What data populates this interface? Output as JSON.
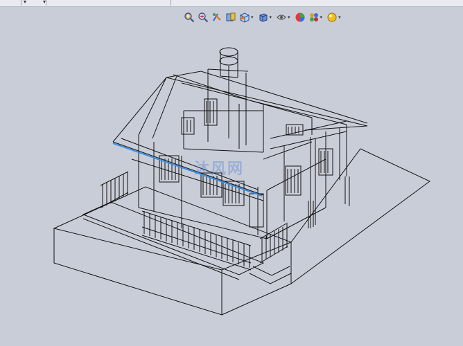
{
  "window": {
    "top_strip_chevron": "▾"
  },
  "heads_up_toolbar": {
    "tools": [
      {
        "name": "zoom-to-fit-icon"
      },
      {
        "name": "zoom-to-area-icon"
      },
      {
        "name": "previous-view-icon"
      },
      {
        "name": "section-view-icon"
      },
      {
        "name": "view-orientation-icon",
        "has_dropdown": true
      },
      {
        "name": "display-style-icon",
        "has_dropdown": true
      },
      {
        "name": "hide-show-items-icon",
        "has_dropdown": true
      },
      {
        "name": "edit-appearance-icon"
      },
      {
        "name": "apply-scene-icon",
        "has_dropdown": true
      },
      {
        "name": "view-settings-icon",
        "has_dropdown": true
      }
    ],
    "dropdown_glyph": "▾"
  },
  "viewport": {
    "model": "house-wireframe",
    "display_style": "wireframe",
    "watermark": "沐风网"
  },
  "colors": {
    "background": "#c9cdd8",
    "edge": "#111111",
    "selected_edge": "#3a8fe0"
  }
}
